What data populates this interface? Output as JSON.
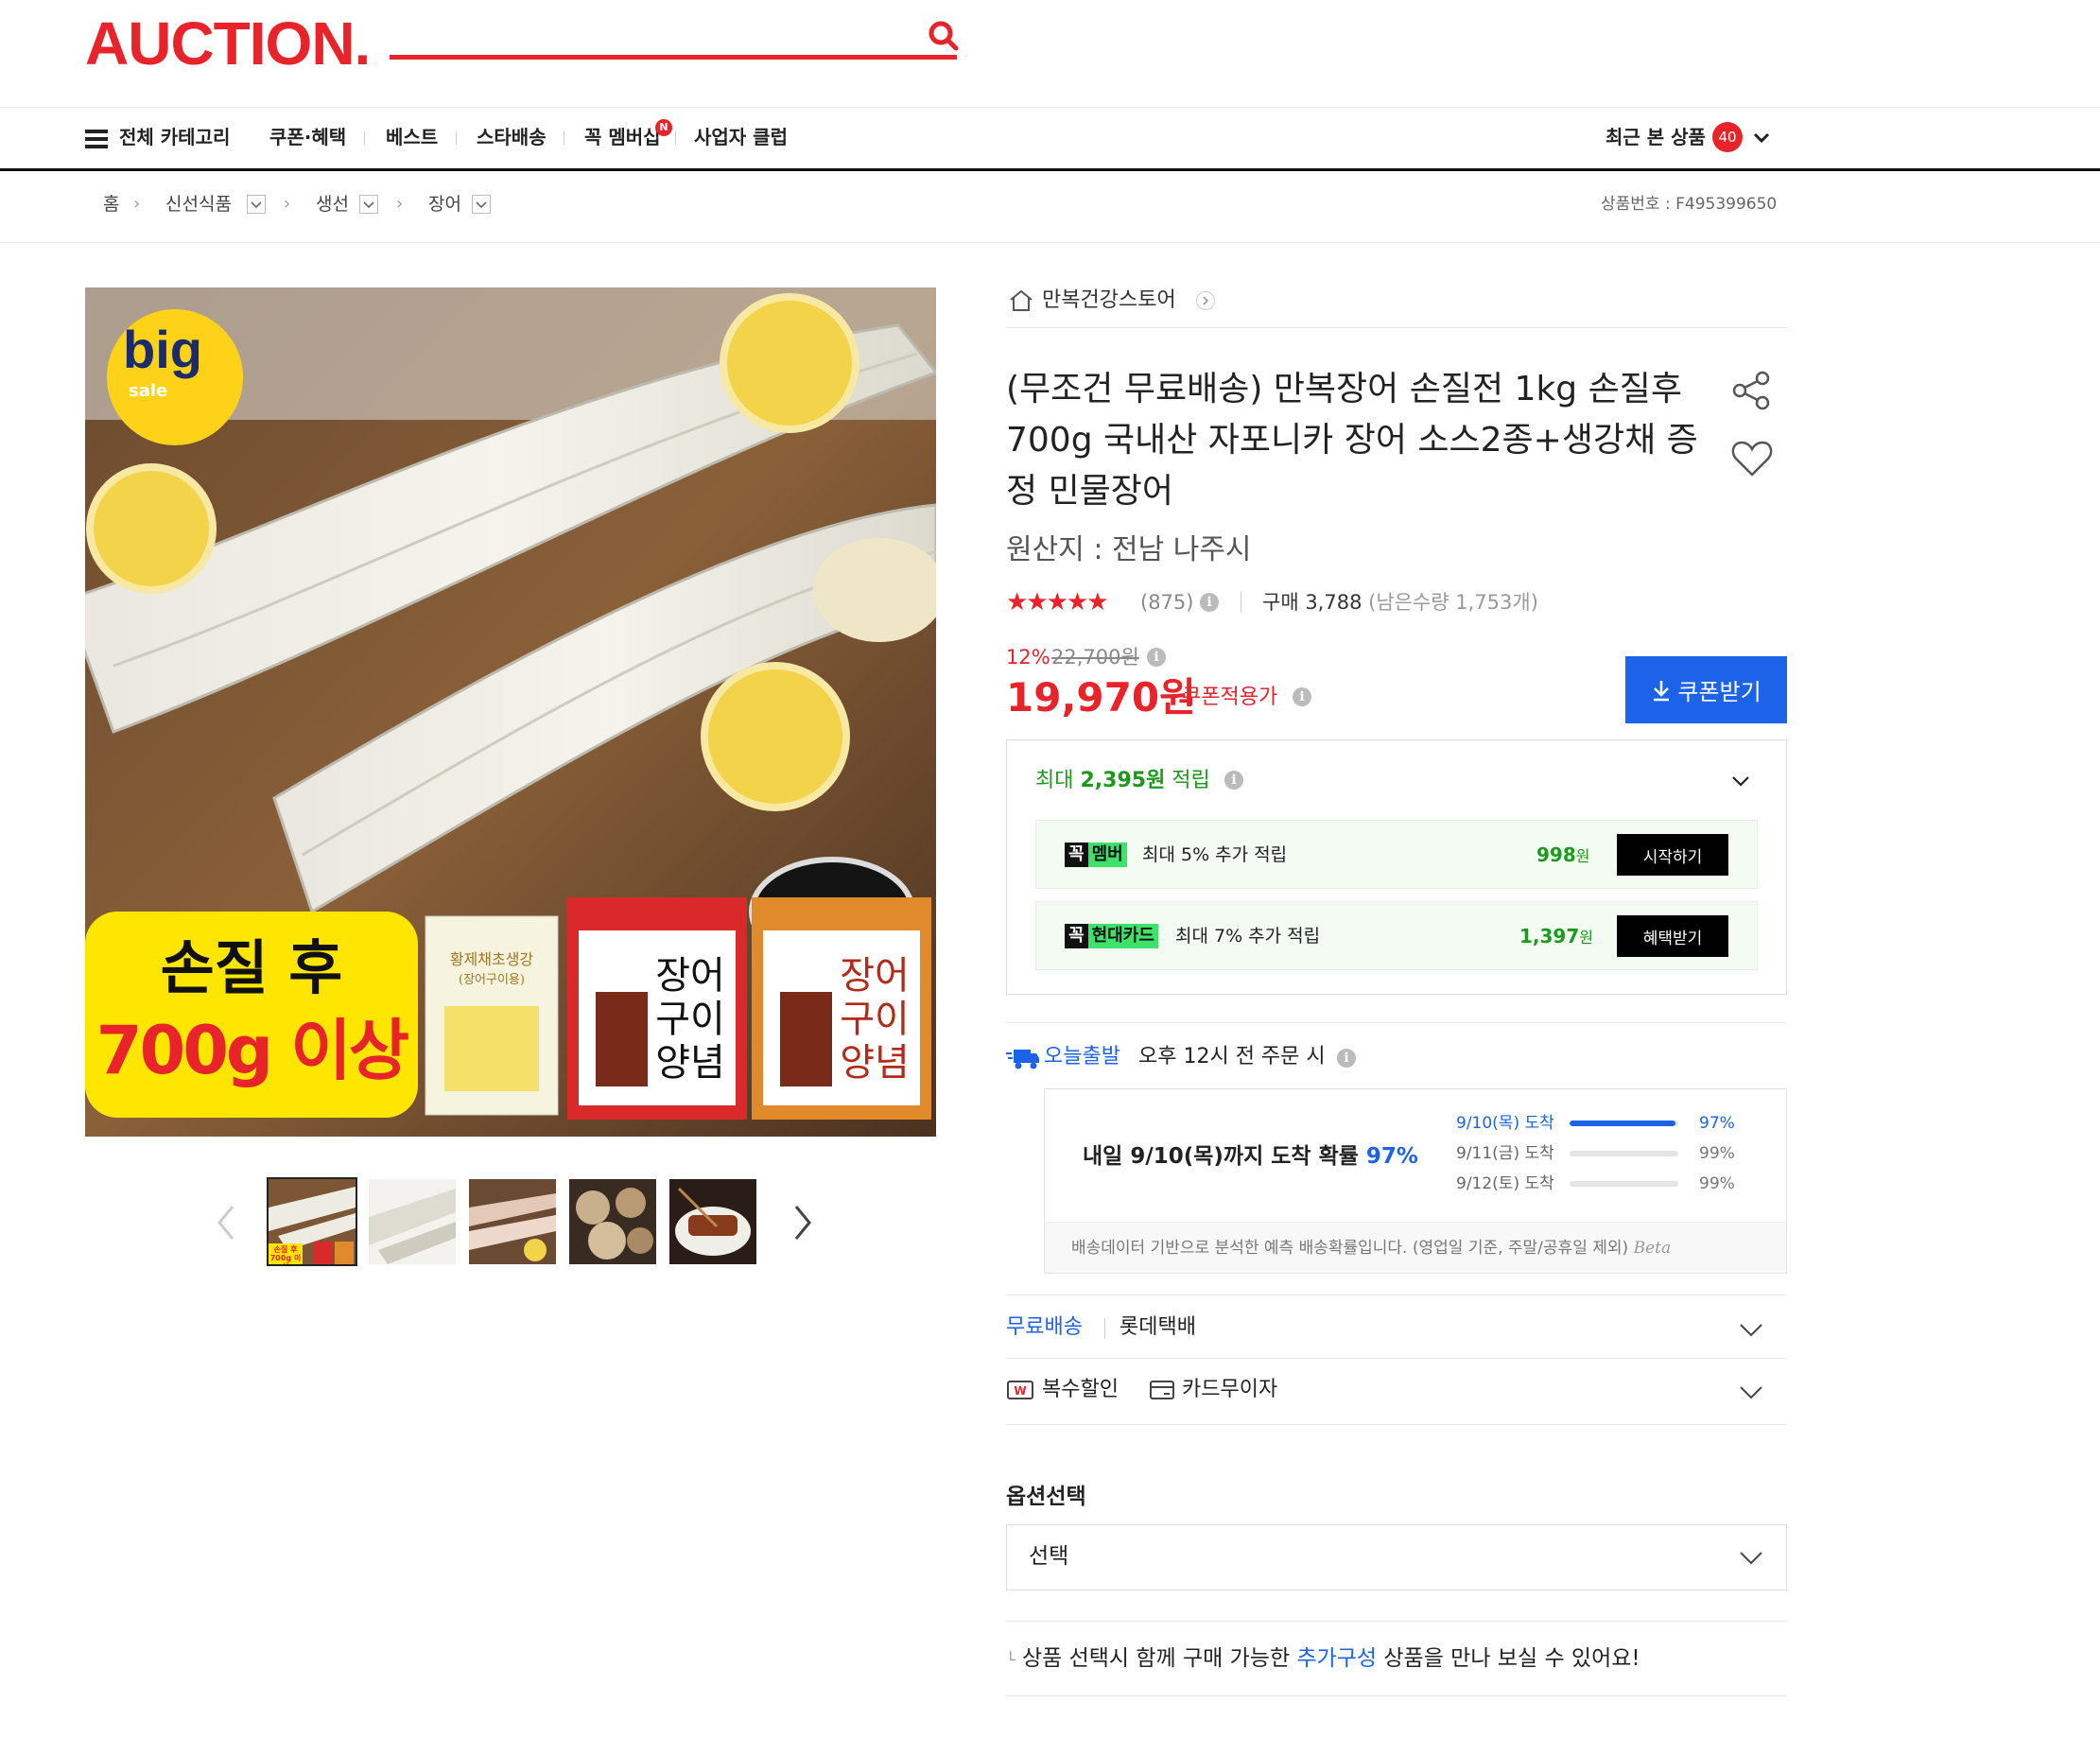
{
  "header": {
    "logo": "AUCTION.",
    "search": {
      "value": ""
    }
  },
  "nav": {
    "all_categories": "전체 카테고리",
    "items": [
      "쿠폰·혜택",
      "베스트",
      "스타배송",
      "꼭 멤버십",
      "사업자 클럽"
    ],
    "membership_badge": "N",
    "recent_label": "최근 본 상품",
    "recent_count": "40"
  },
  "breadcrumb": {
    "home": "홈",
    "levels": [
      "신선식품",
      "생선",
      "장어"
    ],
    "product_number": "상품번호 : F495399650"
  },
  "gallery": {
    "badge_big": "big",
    "badge_sale": "sale",
    "banner_line1": "손질 후",
    "banner_line2": "700g 이상",
    "package_small": "황제채초생강",
    "package_small_sub": "(장어구이용)",
    "sauce_label": "장어구이 양념",
    "thumb_badge": "손질 후 700g 이상",
    "thumbnails": 5
  },
  "product": {
    "store_name": "만복건강스토어",
    "title": "(무조건 무료배송) 만복장어 손질전 1kg 손질후 700g 국내산 자포니카 장어 소스2종+생강채 증정 민물장어",
    "origin": "원산지 : 전남 나주시",
    "rating": 4.5,
    "stars": "★★★★★",
    "review_count": "(875)",
    "purchase_label": "구매 3,788",
    "stock_label": "(남은수량 1,753개)",
    "discount_pct": "12%",
    "original_price": "22,700원",
    "sale_price": "19,970원",
    "coupon_price_label": "쿠폰적용가",
    "coupon_button": "쿠폰받기"
  },
  "rewards": {
    "title_prefix": "최대 ",
    "title_amount": "2,395원",
    "title_suffix": " 적립",
    "rows": [
      {
        "tag_a": "꼭",
        "tag_b": "멤버",
        "text": "최대 5% 추가 적립",
        "amount": "998",
        "unit": "원",
        "button": "시작하기"
      },
      {
        "tag_a": "꼭",
        "tag_b": "현대카드",
        "text": "최대 7% 추가 적립",
        "amount": "1,397",
        "unit": "원",
        "button": "혜택받기"
      }
    ]
  },
  "delivery": {
    "today_label": "오늘출발",
    "today_text": "오후 12시 전 주문 시",
    "prob_main_prefix": "내일 9/10(목)까지 도착 확률 ",
    "prob_main_pct": "97%",
    "rows": [
      {
        "label": "9/10(목) 도착",
        "pct": "97%",
        "value": 0.97
      },
      {
        "label": "9/11(금) 도착",
        "pct": "99%",
        "value": 0
      },
      {
        "label": "9/12(토) 도착",
        "pct": "99%",
        "value": 0
      }
    ],
    "note": "배송데이터 기반으로 분석한 예측 배송확률입니다. (영업일 기준, 주말/공휴일 제외)",
    "beta": "Beta",
    "free_shipping": "무료배송",
    "courier": "롯데택배",
    "multi_discount": "복수할인",
    "card_interest": "카드무이자"
  },
  "options": {
    "title": "옵션선택",
    "select_value": "선택"
  },
  "addon": {
    "prefix": "상품 선택시 함께 구매 가능한 ",
    "link": "추가구성",
    "suffix": " 상품을 만나 보실 수 있어요!"
  },
  "colors": {
    "brand_red": "#e8232a",
    "accent_blue": "#1d63e9",
    "reward_green": "#1a9b1a"
  }
}
